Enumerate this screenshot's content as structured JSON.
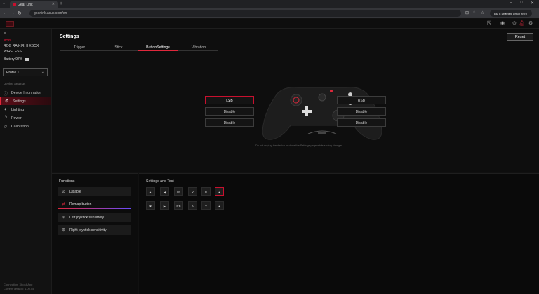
{
  "browser": {
    "tab_title": "Gear Link",
    "url": "gearlink.asus.com/en",
    "incognito_label": "Вы в режиме инкогнито"
  },
  "sidebar": {
    "brand": "ROG",
    "device_name": "ROG RAIKIRI II XBOX WIRELESS",
    "battery_label": "Battery 97%",
    "battery_level": 0.97,
    "profile": "Profile 1",
    "section_title": "Device Settings",
    "items": [
      {
        "label": "Device Information",
        "icon": "info-icon"
      },
      {
        "label": "Settings",
        "icon": "gear-icon",
        "active": true
      },
      {
        "label": "Lighting",
        "icon": "light-icon"
      },
      {
        "label": "Power",
        "icon": "power-icon"
      },
      {
        "label": "Calibration",
        "icon": "calibration-icon"
      }
    ],
    "footer_line1": "Connection: Xbox&App",
    "footer_line2": "Current Version: 1.00.05"
  },
  "main": {
    "title": "Settings",
    "reset_label": "Reset",
    "tabs": [
      {
        "label": "Trigger"
      },
      {
        "label": "Stick"
      },
      {
        "label": "ButtonSettings",
        "active": true
      },
      {
        "label": "Vibration"
      }
    ],
    "left_buttons": [
      {
        "label": "LSB",
        "selected": true
      },
      {
        "label": "Disable"
      },
      {
        "label": "Disable"
      }
    ],
    "right_buttons": [
      {
        "label": "RSB"
      },
      {
        "label": "Disable"
      },
      {
        "label": "Disable"
      }
    ],
    "note": "Do not unplug the device or close the Settings page while saving changes."
  },
  "functions": {
    "title": "Functions",
    "items": [
      {
        "label": "Disable",
        "icon": "disable-icon"
      },
      {
        "label": "Remap button",
        "icon": "remap-icon",
        "active": true
      },
      {
        "label": "Left joystick sensitivity",
        "icon": "joystick-icon"
      },
      {
        "label": "Right joystick sensitivity",
        "icon": "joystick-icon"
      }
    ]
  },
  "settings_test": {
    "title": "Settings and Test",
    "row1": [
      "▲",
      "◀",
      "LB",
      "Y",
      "B",
      "●"
    ],
    "row2": [
      "▼",
      "▶",
      "RB",
      "A",
      "X",
      "●"
    ]
  }
}
